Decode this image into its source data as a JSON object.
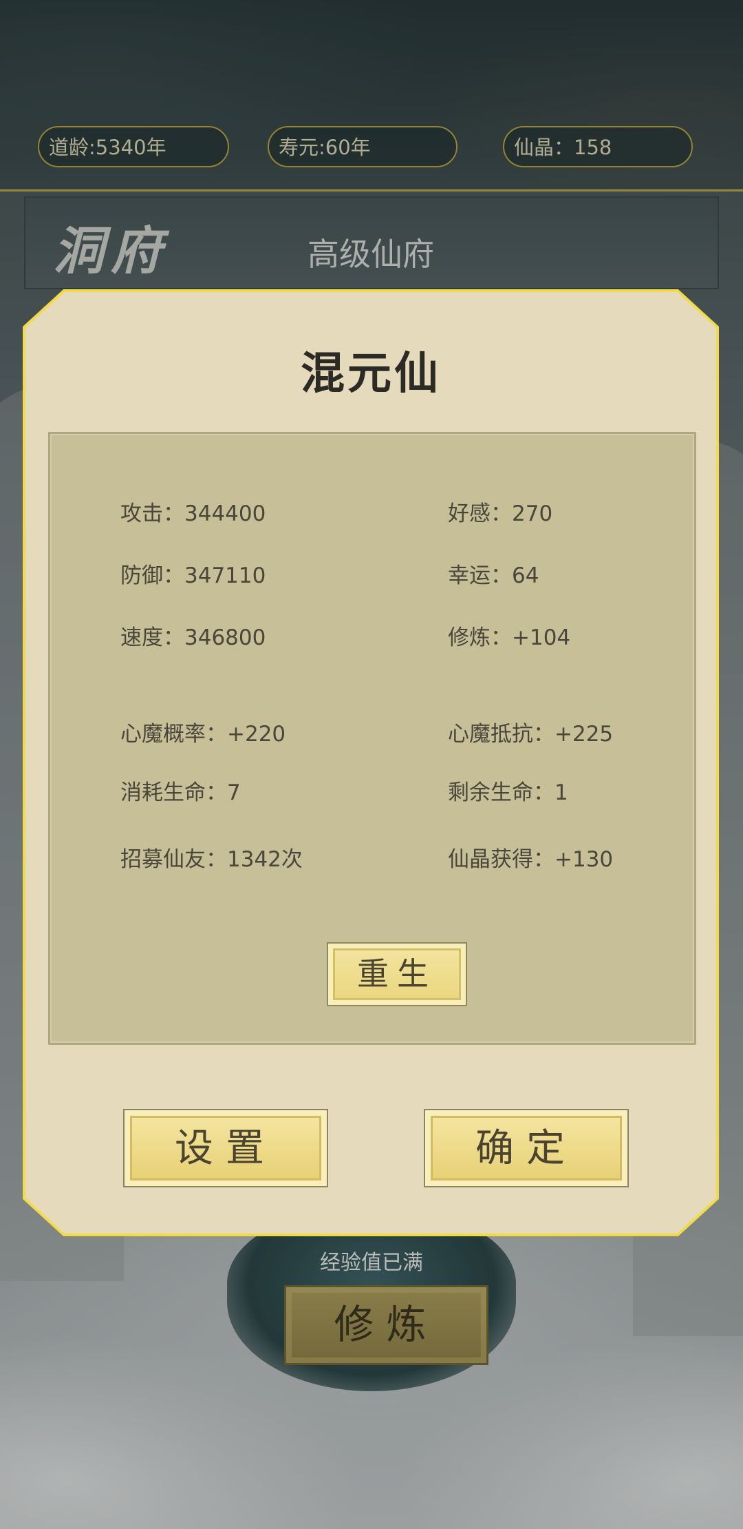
{
  "top_stats": {
    "dao_age": "道龄:5340年",
    "lifespan": "寿元:60年",
    "crystals": "仙晶：158"
  },
  "header": {
    "title": "洞府",
    "residence_name": "高级仙府"
  },
  "background": {
    "exp_status": "经验值已满",
    "cultivate_button": "修炼"
  },
  "modal": {
    "title": "混元仙",
    "stats": [
      {
        "left": "攻击：344400",
        "right": "好感：270"
      },
      {
        "left": "防御：347110",
        "right": "幸运：64"
      },
      {
        "left": "速度：346800",
        "right": "修炼：+104"
      },
      {
        "left": "心魔概率：+220",
        "right": "心魔抵抗：+225"
      },
      {
        "left": "消耗生命：7",
        "right": "剩余生命：1"
      },
      {
        "left": "招募仙友：1342次",
        "right": "仙晶获得：+130"
      }
    ],
    "rebirth_button": "重生",
    "settings_button": "设置",
    "confirm_button": "确定"
  },
  "colors": {
    "modal_bg": "#e6dabc",
    "panel_bg": "#c6bf98",
    "modal_border": "#f0d94a",
    "button_gold": "#e9d57c"
  }
}
